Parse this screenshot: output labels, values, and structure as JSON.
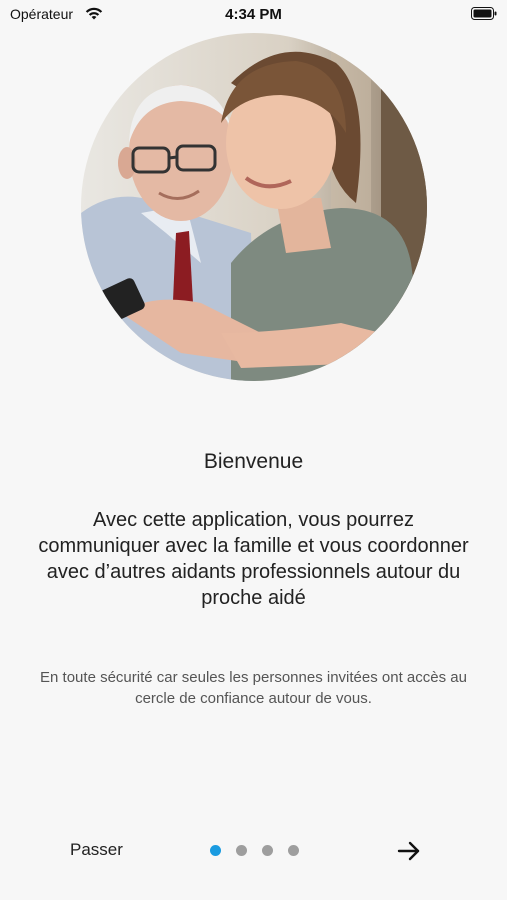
{
  "status_bar": {
    "carrier": "Opérateur",
    "time": "4:34 PM",
    "wifi_icon": "wifi-icon",
    "battery_icon": "battery-icon"
  },
  "onboarding": {
    "image_alt": "elderly-man-and-young-woman-using-phone",
    "title": "Bienvenue",
    "description": "Avec cette application, vous pourrez communiquer avec la famille et vous coordonner avec d’autres aidants professionnels autour du proche aidé",
    "note": "En toute sécurité car seules les personnes invitées ont accès au cercle de confiance autour de vous.",
    "page_index": 1,
    "page_count": 4
  },
  "footer": {
    "skip_label": "Passer",
    "next_icon": "arrow-right-icon"
  },
  "colors": {
    "background": "#f7f7f7",
    "accent": "#1a9be0",
    "inactive_dot": "#9e9e9e"
  }
}
